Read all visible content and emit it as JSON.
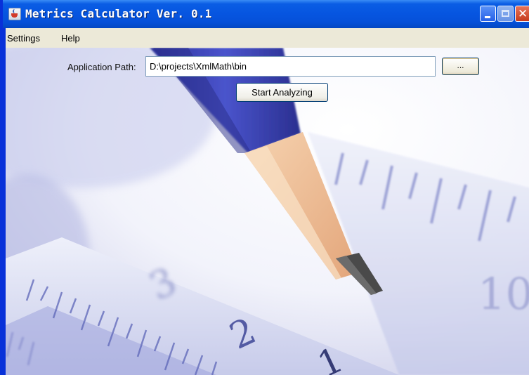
{
  "window": {
    "title": "Metrics Calculator Ver. 0.1"
  },
  "menu": {
    "items": [
      {
        "label": "Settings"
      },
      {
        "label": "Help"
      }
    ]
  },
  "form": {
    "path_label": "Application Path:",
    "path_value": "D:\\projects\\XmlMath\\bin",
    "browse_label": "...",
    "start_label": "Start Analyzing"
  },
  "background": {
    "ruler_numbers": [
      "3",
      "2",
      "1",
      "10"
    ]
  },
  "colors": {
    "titlebar": "#0a5de4",
    "menubar": "#ece9d8",
    "pencil_body": "#3a43b8",
    "pencil_wood": "#f2c39a"
  }
}
